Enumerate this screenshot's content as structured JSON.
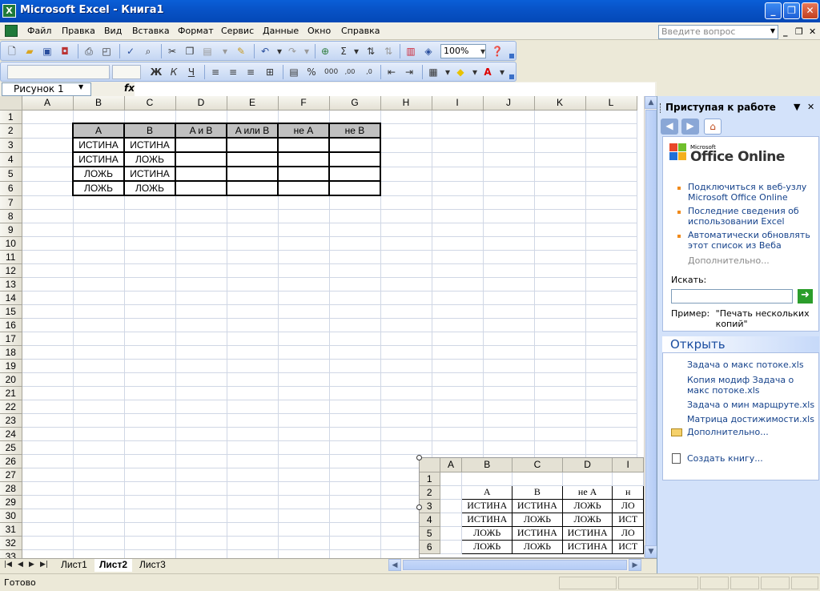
{
  "window": {
    "title": "Microsoft Excel - Книга1",
    "app_icon": "excel-icon",
    "minimize": "_",
    "restore": "❐",
    "close": "✕"
  },
  "menu": {
    "items": [
      "Файл",
      "Правка",
      "Вид",
      "Вставка",
      "Формат",
      "Сервис",
      "Данные",
      "Окно",
      "Справка"
    ],
    "ask_placeholder": "Введите вопрос",
    "mdi_min": "_",
    "mdi_restore": "❐",
    "mdi_close": "✕"
  },
  "toolbar": {
    "zoom": "100%"
  },
  "formula_bar": {
    "name_box": "Рисунок 1",
    "fx": "fx",
    "formula": ""
  },
  "sheet": {
    "columns": [
      "A",
      "B",
      "C",
      "D",
      "E",
      "F",
      "G",
      "H",
      "I",
      "J",
      "K",
      "L"
    ],
    "row_count": 33,
    "table_headers": [
      "A",
      "B",
      "A и B",
      "A или B",
      "не A",
      "не B"
    ],
    "table_rows": [
      [
        "ИСТИНА",
        "ИСТИНА"
      ],
      [
        "ИСТИНА",
        "ЛОЖЬ"
      ],
      [
        "ЛОЖЬ",
        "ИСТИНА"
      ],
      [
        "ЛОЖЬ",
        "ЛОЖЬ"
      ]
    ]
  },
  "picture": {
    "columns": [
      "A",
      "B",
      "C",
      "D",
      "I"
    ],
    "row_numbers": [
      "1",
      "2",
      "3",
      "4",
      "5",
      "6"
    ],
    "headers": [
      "A",
      "B",
      "не A",
      "н"
    ],
    "rows": [
      [
        "ИСТИНА",
        "ИСТИНА",
        "ЛОЖЬ",
        "ЛО"
      ],
      [
        "ИСТИНА",
        "ЛОЖЬ",
        "ЛОЖЬ",
        "ИСТ"
      ],
      [
        "ЛОЖЬ",
        "ИСТИНА",
        "ИСТИНА",
        "ЛО"
      ],
      [
        "ЛОЖЬ",
        "ЛОЖЬ",
        "ИСТИНА",
        "ИСТ"
      ]
    ]
  },
  "tabs": {
    "sheets": [
      "Лист1",
      "Лист2",
      "Лист3"
    ],
    "active": "Лист2"
  },
  "status": {
    "text": "Готово"
  },
  "taskpane": {
    "title": "Приступая к работе",
    "logo_small": "Microsoft",
    "logo": "Office Online",
    "links": [
      "Подключиться к веб-узлу Microsoft Office Online",
      "Последние сведения об использовании Excel",
      "Автоматически обновлять этот список из Веба"
    ],
    "more": "Дополнительно...",
    "search_label": "Искать:",
    "search_value": "",
    "example_label": "Пример:",
    "example_text": "\"Печать нескольких копий\"",
    "open_title": "Открыть",
    "open_files": [
      "Задача о макс потоке.xls",
      "Копия модиф Задача о макс потоке.xls",
      "Задача о мин марщруте.xls",
      "Матрица достижимости.xls"
    ],
    "open_more": "Дополнительно...",
    "create_book": "Создать книгу..."
  }
}
